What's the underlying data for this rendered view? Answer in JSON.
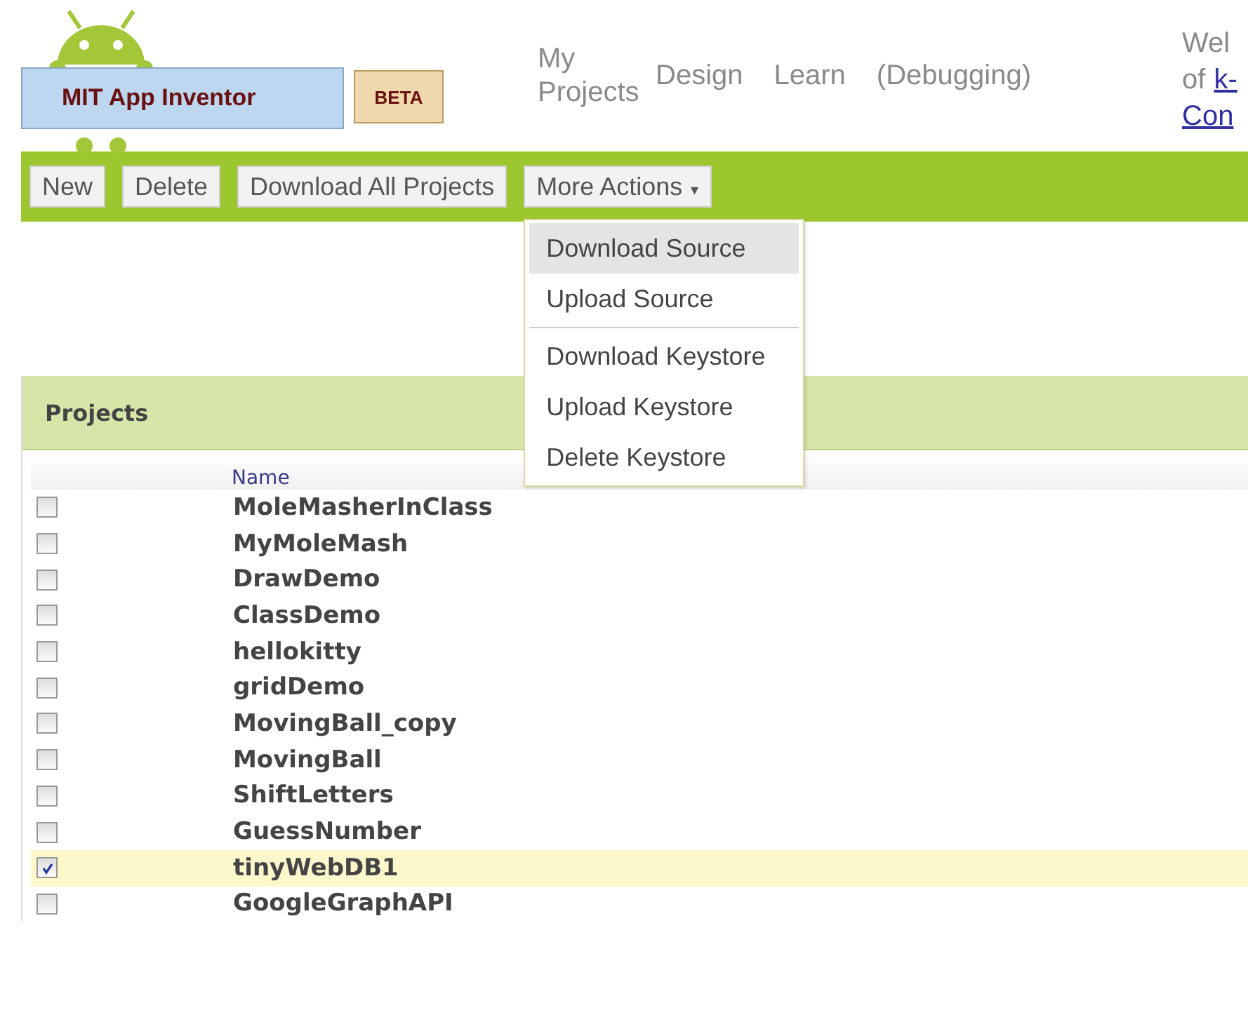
{
  "logo": {
    "title": "MIT App Inventor",
    "badge": "BETA"
  },
  "nav": [
    {
      "label": "My Projects"
    },
    {
      "label": "Design"
    },
    {
      "label": "Learn"
    },
    {
      "label": "(Debugging)"
    }
  ],
  "welcome": {
    "line_1": "Wel",
    "line_2_prefix": "of",
    "line_2_link": "k-",
    "line_3_link": "Con"
  },
  "toolbar": [
    {
      "label": "New",
      "kind": "button"
    },
    {
      "label": "Delete",
      "kind": "button"
    },
    {
      "label": "Download All Projects",
      "kind": "button"
    },
    {
      "label": "More Actions",
      "kind": "menu",
      "caret": "▾"
    }
  ],
  "menu": [
    {
      "label": "Download Source",
      "highlighted": true,
      "divider_before": false
    },
    {
      "label": "Upload Source",
      "highlighted": false,
      "divider_before": false
    },
    {
      "label": "Download Keystore",
      "highlighted": false,
      "divider_before": true
    },
    {
      "label": "Upload Keystore",
      "highlighted": false,
      "divider_before": false
    },
    {
      "label": "Delete Keystore",
      "highlighted": false,
      "divider_before": false
    }
  ],
  "projects": {
    "title": "Projects",
    "column": "Name",
    "rows": [
      {
        "name": "MoleMasherInClass",
        "checked": false,
        "selected": false
      },
      {
        "name": "MyMoleMash",
        "checked": false,
        "selected": false
      },
      {
        "name": "DrawDemo",
        "checked": false,
        "selected": false
      },
      {
        "name": "ClassDemo",
        "checked": false,
        "selected": false
      },
      {
        "name": "hellokitty",
        "checked": false,
        "selected": false
      },
      {
        "name": "gridDemo",
        "checked": false,
        "selected": false
      },
      {
        "name": "MovingBall_copy",
        "checked": false,
        "selected": false
      },
      {
        "name": "MovingBall",
        "checked": false,
        "selected": false
      },
      {
        "name": "ShiftLetters",
        "checked": false,
        "selected": false
      },
      {
        "name": "GuessNumber",
        "checked": false,
        "selected": false
      },
      {
        "name": "tinyWebDB1",
        "checked": true,
        "selected": true
      },
      {
        "name": "GoogleGraphAPI",
        "checked": false,
        "selected": false
      }
    ]
  }
}
